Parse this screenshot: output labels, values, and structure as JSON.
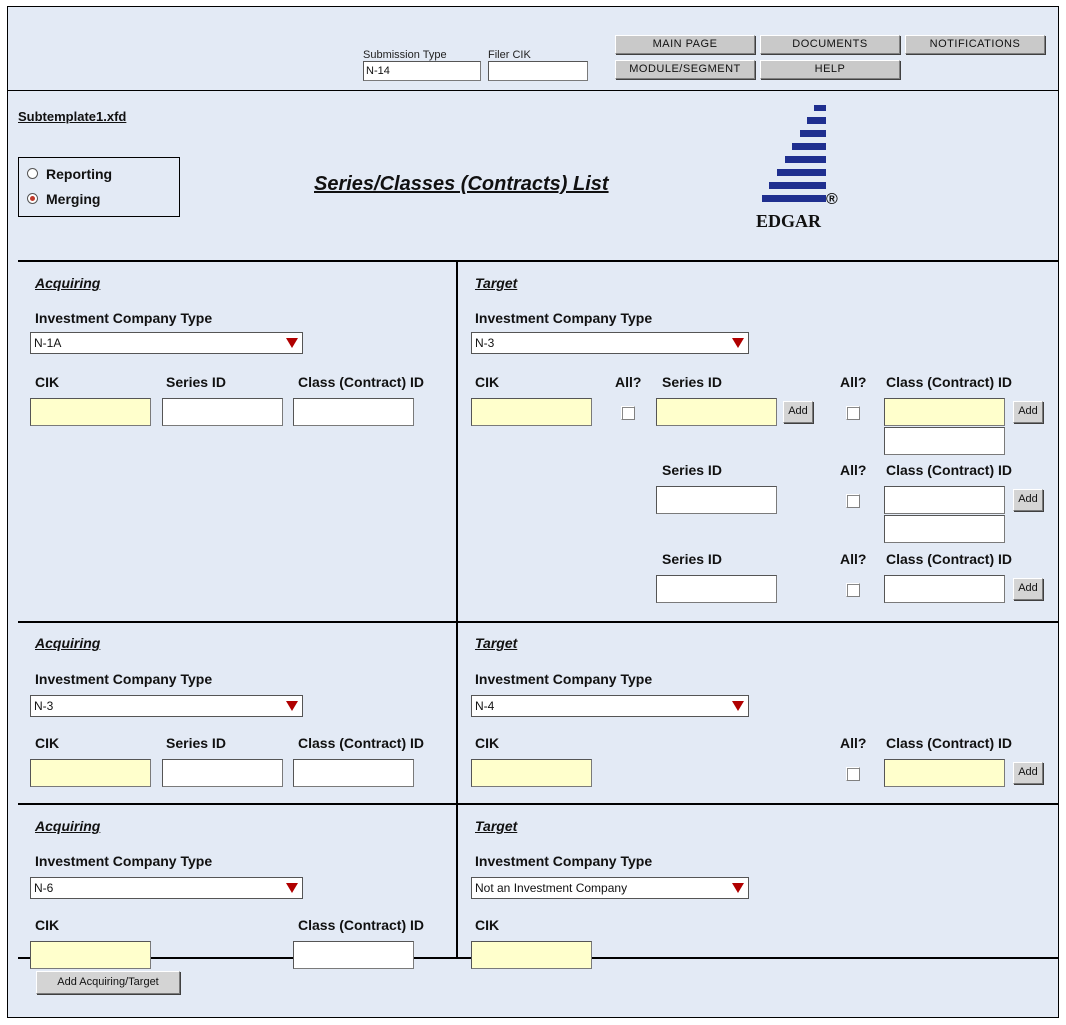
{
  "header": {
    "submission_type_label": "Submission Type",
    "submission_type_value": "N-14",
    "filer_cik_label": "Filer CIK",
    "filer_cik_value": "",
    "nav": {
      "main_page": "MAIN PAGE",
      "documents": "DOCUMENTS",
      "notifications": "NOTIFICATIONS",
      "module_segment": "MODULE/SEGMENT",
      "help": "HELP"
    }
  },
  "page": {
    "filename": "Subtemplate1.xfd",
    "title": "Series/Classes (Contracts) List",
    "logo_text": "EDGAR",
    "logo_mark": "®"
  },
  "mode": {
    "options": [
      "Reporting",
      "Merging"
    ],
    "selected": "Merging"
  },
  "labels": {
    "acquiring": "Acquiring",
    "target": "Target",
    "ict": "Investment Company Type",
    "cik": "CIK",
    "series_id": "Series ID",
    "class_id": "Class (Contract) ID",
    "all": "All?",
    "add": "Add"
  },
  "groups": [
    {
      "acquiring": {
        "type": "N-1A"
      },
      "target": {
        "type": "N-3"
      }
    },
    {
      "acquiring": {
        "type": "N-3"
      },
      "target": {
        "type": "N-4"
      }
    },
    {
      "acquiring": {
        "type": "N-6"
      },
      "target": {
        "type": "Not an Investment Company"
      }
    }
  ],
  "footer": {
    "add_acquiring_target": "Add Acquiring/Target"
  },
  "colors": {
    "background": "#e3eaf5",
    "required_field": "#ffffcc",
    "dropdown_arrow": "#b00000",
    "logo_blue": "#1f2f8f"
  }
}
